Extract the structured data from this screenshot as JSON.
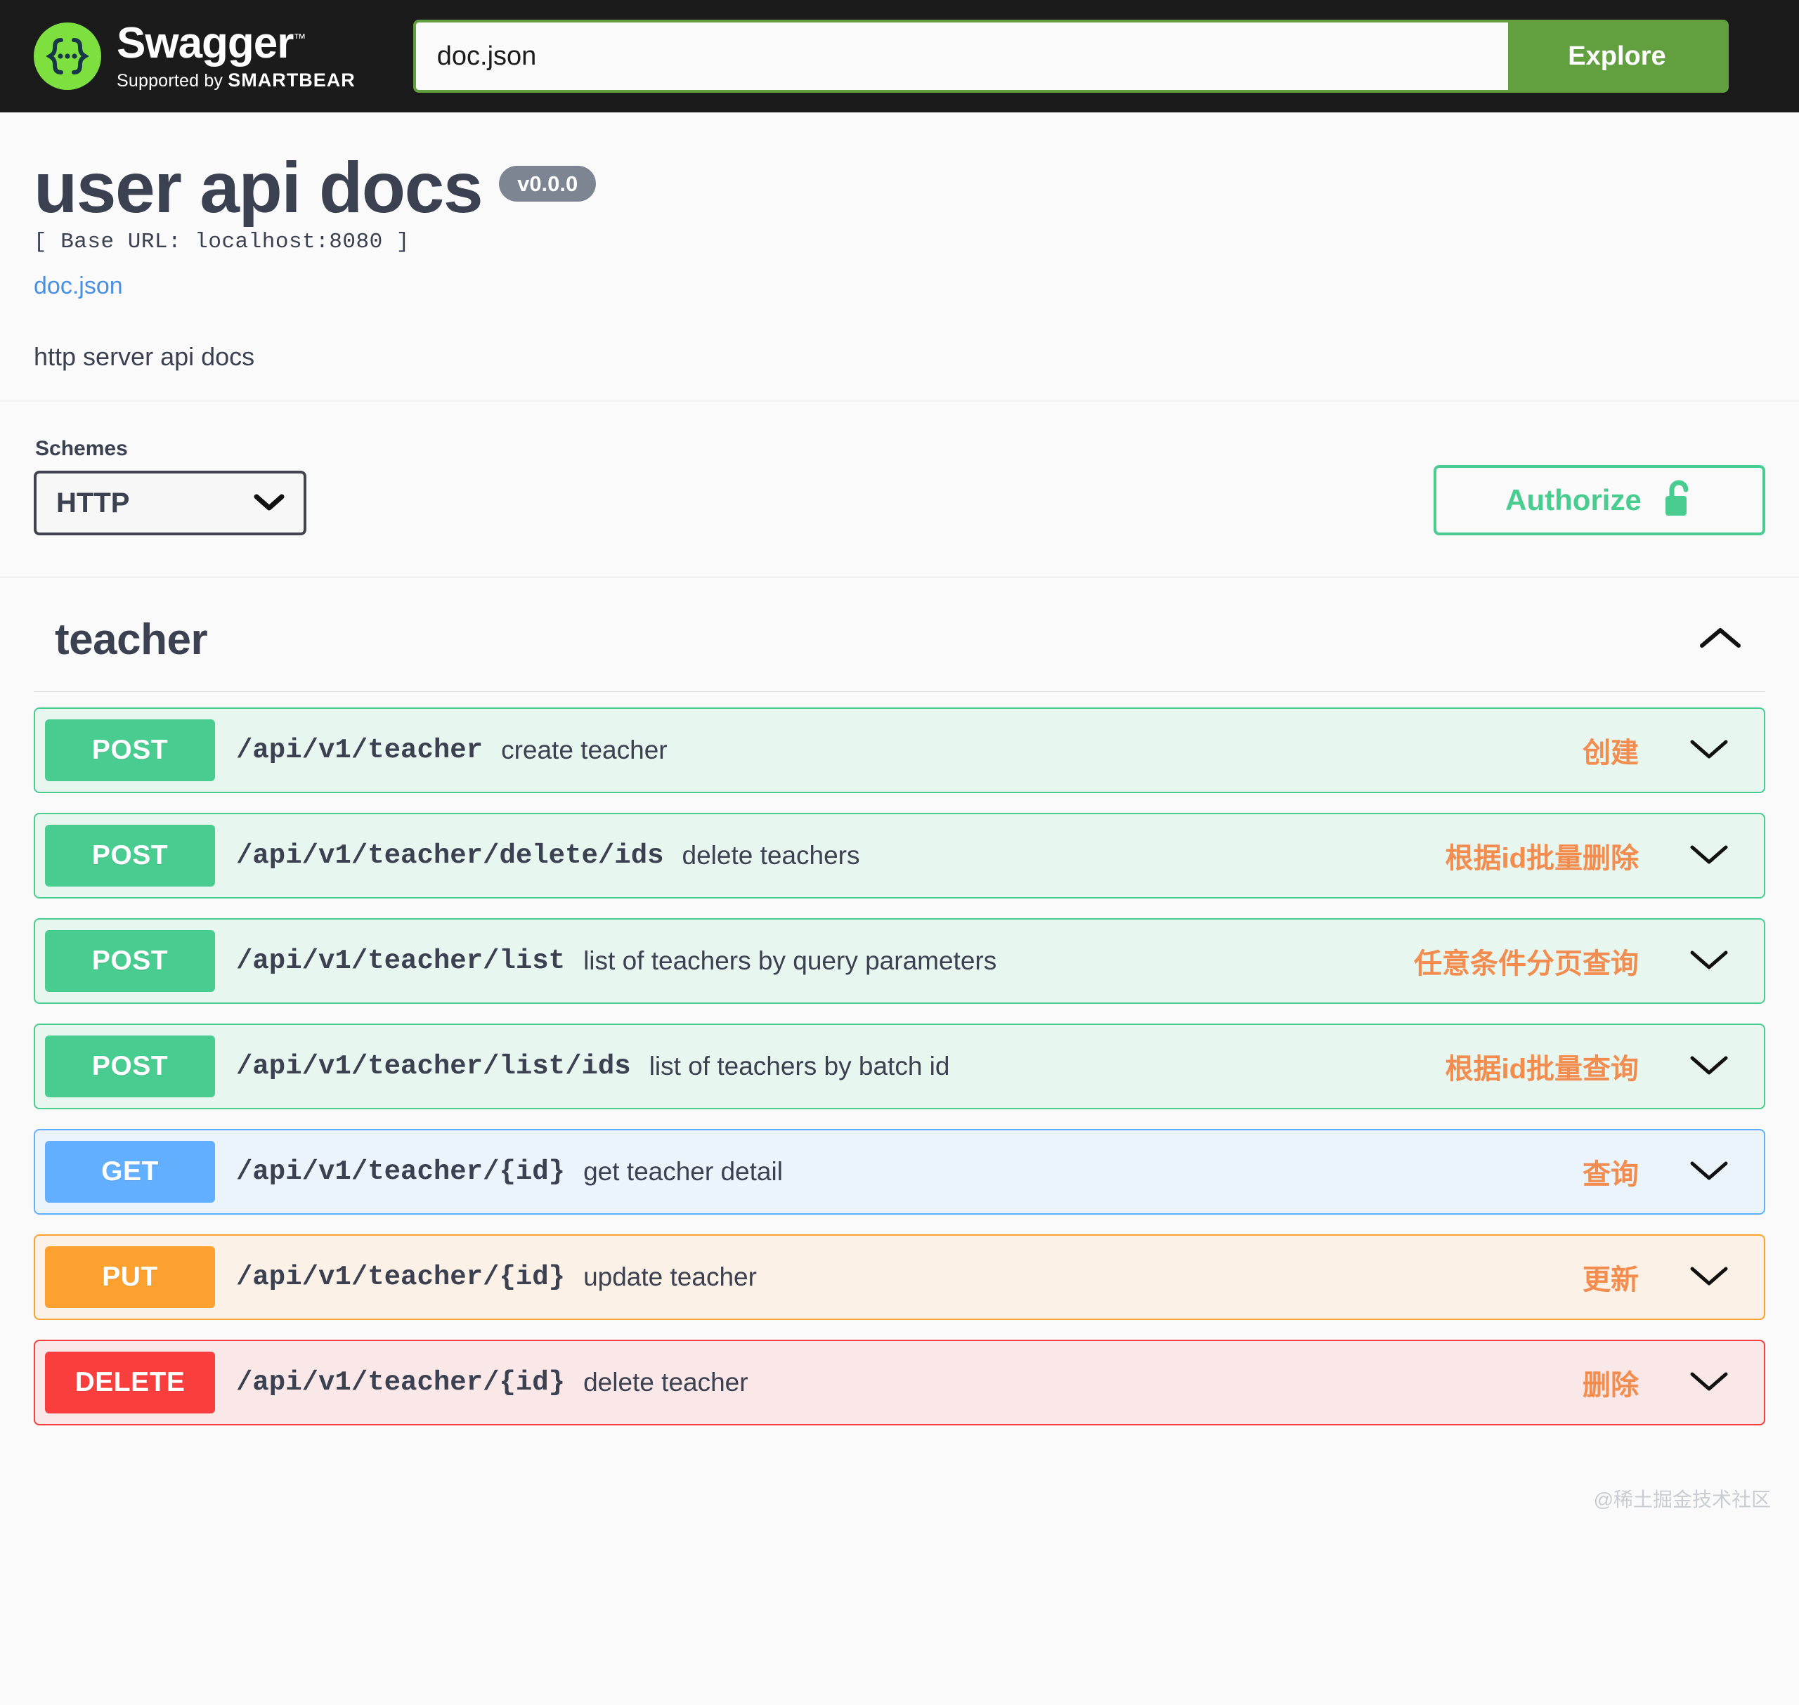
{
  "header": {
    "logo_title": "Swagger",
    "logo_tm": "™",
    "logo_supported_prefix": "Supported by",
    "logo_brand": "SMARTBEAR",
    "url_value": "doc.json",
    "url_placeholder": "doc.json",
    "explore_label": "Explore"
  },
  "info": {
    "title": "user api docs",
    "version": "v0.0.0",
    "base_url": "[ Base URL: localhost:8080 ]",
    "doc_link": "doc.json",
    "description": "http server api docs"
  },
  "schemes": {
    "label": "Schemes",
    "selected": "HTTP",
    "options": [
      "HTTP"
    ]
  },
  "authorize": {
    "label": "Authorize",
    "state": "unlocked"
  },
  "tag": {
    "name": "teacher",
    "expanded": true
  },
  "colors": {
    "post": "#49cc90",
    "get": "#61affe",
    "put": "#fca130",
    "delete": "#f93e3e",
    "summary_text": "#f38d4f",
    "link": "#4990e2",
    "brand_green": "#62a03f",
    "logo_green": "#7ee03f",
    "text": "#3b4151"
  },
  "operations": [
    {
      "method": "POST",
      "method_class": "post",
      "path": "/api/v1/teacher",
      "description": "create teacher",
      "summary": "创建"
    },
    {
      "method": "POST",
      "method_class": "post",
      "path": "/api/v1/teacher/delete/ids",
      "description": "delete teachers",
      "summary": "根据id批量删除"
    },
    {
      "method": "POST",
      "method_class": "post",
      "path": "/api/v1/teacher/list",
      "description": "list of teachers by query parameters",
      "summary": "任意条件分页查询"
    },
    {
      "method": "POST",
      "method_class": "post",
      "path": "/api/v1/teacher/list/ids",
      "description": "list of teachers by batch id",
      "summary": "根据id批量查询"
    },
    {
      "method": "GET",
      "method_class": "get",
      "path": "/api/v1/teacher/{id}",
      "description": "get teacher detail",
      "summary": "查询"
    },
    {
      "method": "PUT",
      "method_class": "put",
      "path": "/api/v1/teacher/{id}",
      "description": "update teacher",
      "summary": "更新"
    },
    {
      "method": "DELETE",
      "method_class": "delete",
      "path": "/api/v1/teacher/{id}",
      "description": "delete teacher",
      "summary": "删除"
    }
  ],
  "watermark": "@稀土掘金技术社区"
}
